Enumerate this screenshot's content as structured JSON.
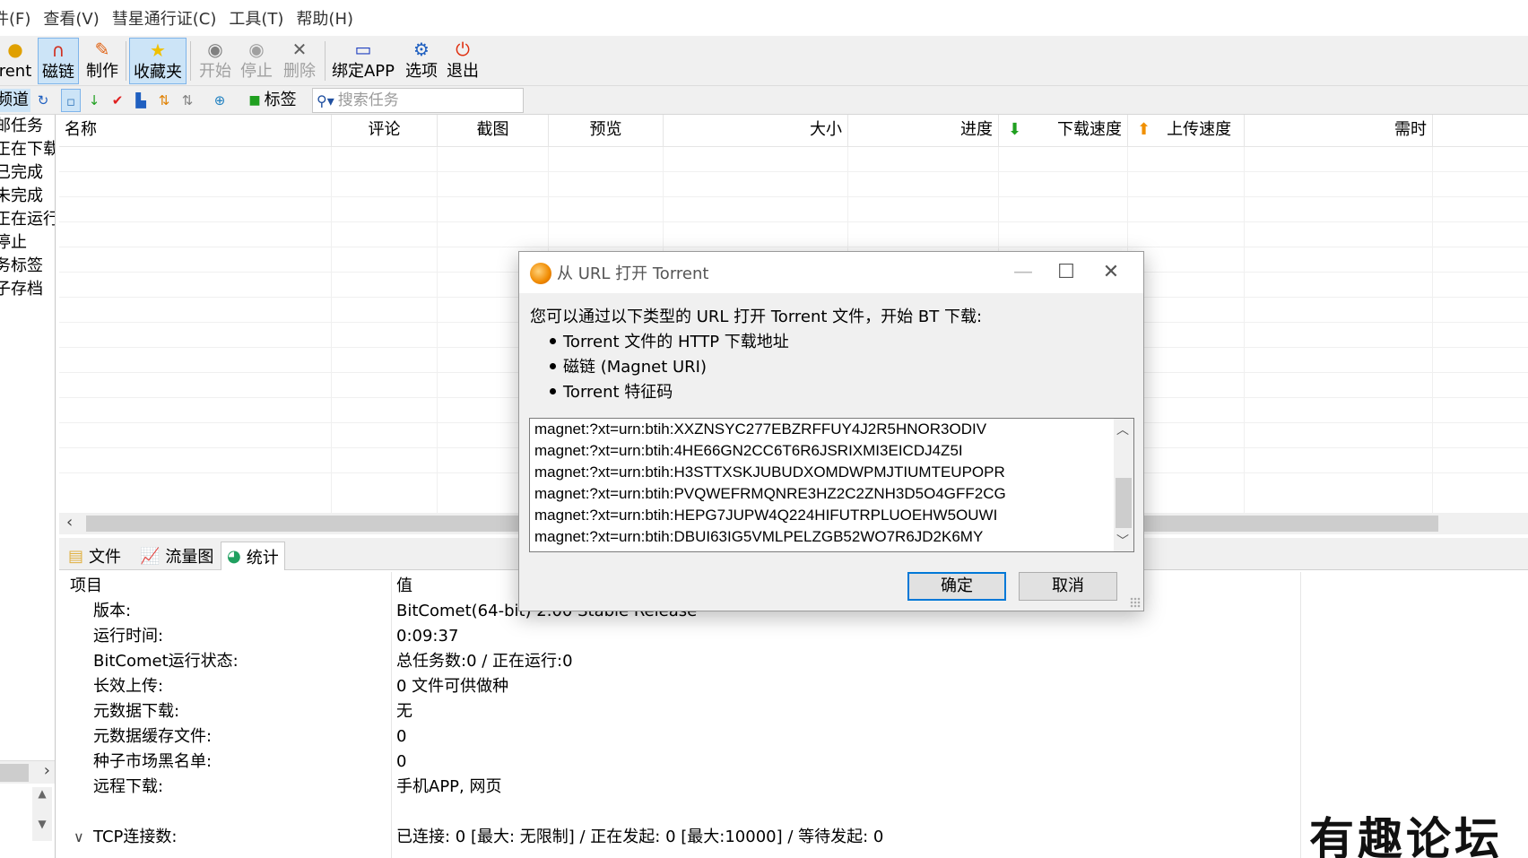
{
  "menu": [
    "件(F)",
    "查看(V)",
    "彗星通行证(C)",
    "工具(T)",
    "帮助(H)"
  ],
  "toolbar": {
    "torrent": "rent",
    "magnet": "磁链",
    "make": "制作",
    "favorites": "收藏夹",
    "start": "开始",
    "stop": "停止",
    "delete": "删除",
    "bind_app": "绑定APP",
    "options": "选项",
    "exit": "退出"
  },
  "toolbar2": {
    "channel_tab": "频道",
    "tags": "标签",
    "search_placeholder": "搜索任务"
  },
  "sidebar": [
    "邮任务",
    "正在下载",
    "已完成",
    "未完成",
    "正在运行",
    "停止",
    "务标签",
    "子存档"
  ],
  "list_columns": [
    "名称",
    "评论",
    "截图",
    "预览",
    "大小",
    "进度",
    "下载速度",
    "上传速度",
    "需时"
  ],
  "tabs": [
    "文件",
    "流量图",
    "统计"
  ],
  "stats": {
    "header_key": "项目",
    "header_val": "值",
    "rows": [
      {
        "key": "版本:",
        "val": "BitComet(64-bit) 2.00 Stable Release"
      },
      {
        "key": "运行时间:",
        "val": "0:09:37"
      },
      {
        "key": "BitComet运行状态:",
        "val": "总任务数:0 / 正在运行:0"
      },
      {
        "key": "长效上传:",
        "val": "0 文件可供做种"
      },
      {
        "key": "元数据下载:",
        "val": "无"
      },
      {
        "key": "元数据缓存文件:",
        "val": "0"
      },
      {
        "key": "种子市场黑名单:",
        "val": "0"
      },
      {
        "key": "远程下载:",
        "val": "手机APP, 网页"
      }
    ],
    "tcp_key": "TCP连接数:",
    "tcp_val": "已连接: 0 [最大: 无限制] / 正在发起: 0 [最大:10000] / 等待发起: 0"
  },
  "dialog": {
    "title": "从 URL 打开 Torrent",
    "intro": "您可以通过以下类型的 URL 打开 Torrent 文件，开始 BT 下载:",
    "bullets": [
      "Torrent 文件的 HTTP 下载地址",
      "磁链 (Magnet URI)",
      "Torrent 特征码"
    ],
    "urls": [
      "magnet:?xt=urn:btih:XXZNSYC277EBZRFFUY4J2R5HNOR3ODIV",
      "magnet:?xt=urn:btih:4HE66GN2CC6T6R6JSRIXMI3EICDJ4Z5I",
      "magnet:?xt=urn:btih:H3STTXSKJUBUDXOMDWPMJTIUMTEUPOPR",
      "magnet:?xt=urn:btih:PVQWEFRMQNRE3HZ2C2ZNH3D5O4GFF2CG",
      "magnet:?xt=urn:btih:HEPG7JUPW4Q224HIFUTRPLUOEHW5OUWI",
      "magnet:?xt=urn:btih:DBUI63IG5VMLPELZGB52WO7R6JD2K6MY"
    ],
    "ok": "确定",
    "cancel": "取消"
  },
  "watermark": "有趣论坛",
  "colors": {
    "accent": "#0078d7",
    "toolbar_bg": "#f0f0f0",
    "active_btn": "#cce4f7"
  }
}
